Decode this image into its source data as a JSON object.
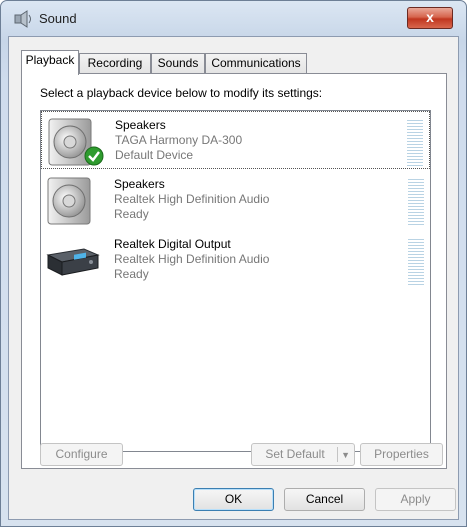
{
  "window": {
    "title": "Sound",
    "close_label": "x"
  },
  "tabs": [
    {
      "label": "Playback",
      "active": true
    },
    {
      "label": "Recording",
      "active": false
    },
    {
      "label": "Sounds",
      "active": false
    },
    {
      "label": "Communications",
      "active": false
    }
  ],
  "playback": {
    "instruction": "Select a playback device below to modify its settings:",
    "devices": [
      {
        "name": "Speakers",
        "description": "TAGA Harmony DA-300",
        "status": "Default Device",
        "icon": "speaker-icon",
        "default_badge": "check-icon",
        "selected": true
      },
      {
        "name": "Speakers",
        "description": "Realtek High Definition Audio",
        "status": "Ready",
        "icon": "speaker-icon",
        "selected": false
      },
      {
        "name": "Realtek Digital Output",
        "description": "Realtek High Definition Audio",
        "status": "Ready",
        "icon": "digital-output-icon",
        "selected": false
      }
    ],
    "configure_label": "Configure",
    "set_default_label": "Set Default",
    "properties_label": "Properties"
  },
  "footer": {
    "ok_label": "OK",
    "cancel_label": "Cancel",
    "apply_label": "Apply"
  },
  "colors": {
    "default_check": "#2e9b2e",
    "close_button": "#c7432c"
  }
}
